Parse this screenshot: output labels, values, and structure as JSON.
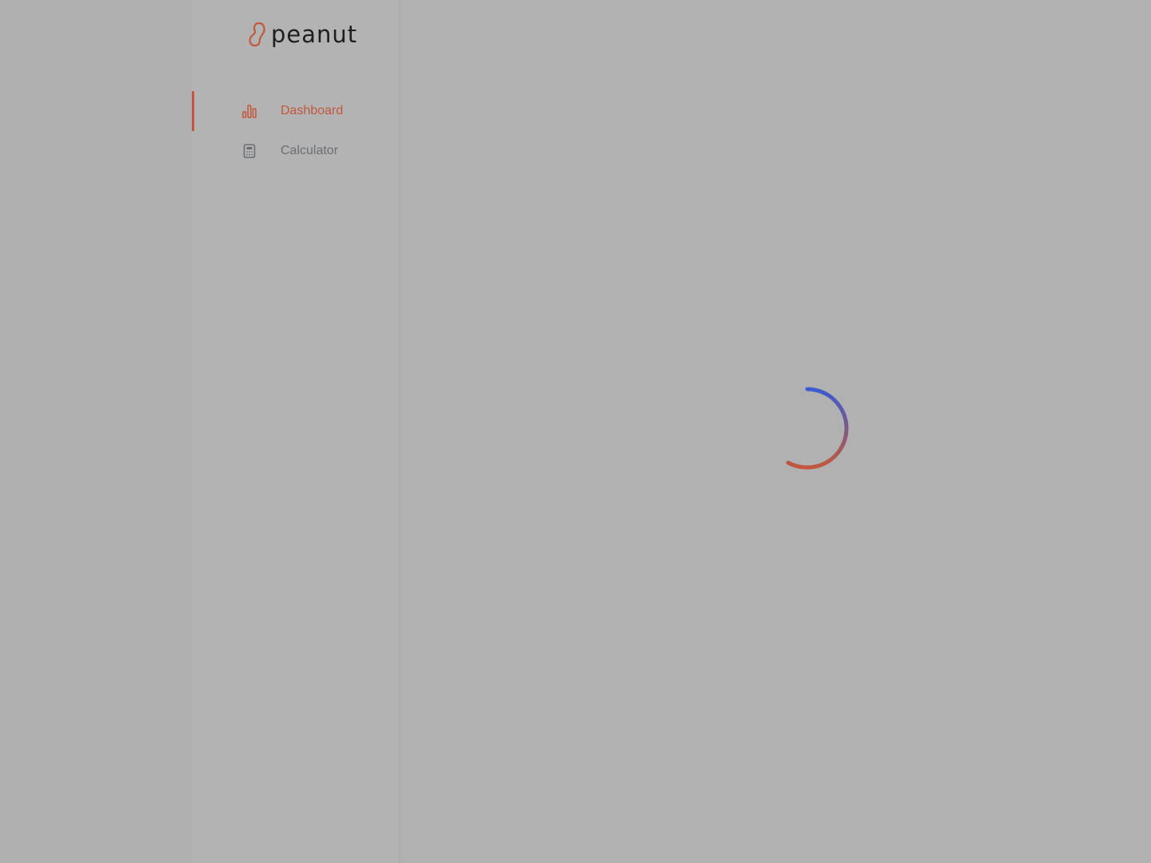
{
  "app": {
    "brand": "peanut"
  },
  "sidebar": {
    "items": [
      {
        "label": "Dashboard",
        "icon": "bar-chart-icon",
        "active": true
      },
      {
        "label": "Calculator",
        "icon": "calculator-icon",
        "active": false
      }
    ]
  },
  "main": {
    "loading": true
  },
  "colors": {
    "accent": "#c2573d",
    "inactive_text": "#6b6e75",
    "spinner_start": "#3b5bd1",
    "spinner_end": "#c2573d"
  }
}
